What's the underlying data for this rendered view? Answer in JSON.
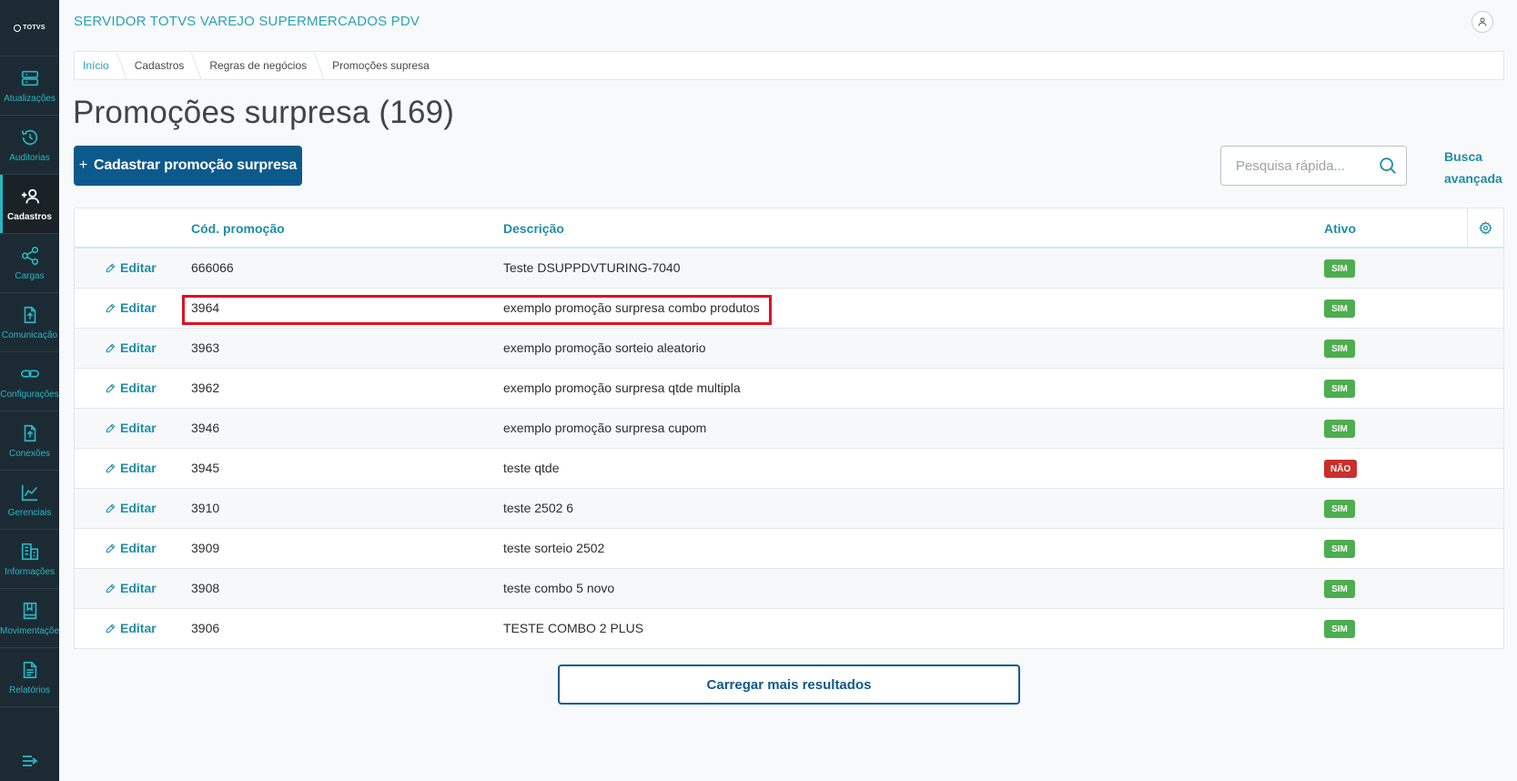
{
  "brand": {
    "logo_text": "TOTVS"
  },
  "header": {
    "app_title": "SERVIDOR TOTVS VAREJO SUPERMERCADOS PDV"
  },
  "sidebar": {
    "items": [
      {
        "label": "Atualizações",
        "icon": "server-icon",
        "active": false
      },
      {
        "label": "Auditorias",
        "icon": "history-icon",
        "active": false
      },
      {
        "label": "Cadastros",
        "icon": "add-user-icon",
        "active": true
      },
      {
        "label": "Cargas",
        "icon": "share-icon",
        "active": false
      },
      {
        "label": "Comunicação",
        "icon": "upload-file-icon",
        "active": false
      },
      {
        "label": "Configurações",
        "icon": "link-icon",
        "active": false
      },
      {
        "label": "Conexões",
        "icon": "upload-file-icon",
        "active": false
      },
      {
        "label": "Gerenciais",
        "icon": "chart-icon",
        "active": false
      },
      {
        "label": "Informações",
        "icon": "building-icon",
        "active": false
      },
      {
        "label": "Movimentações",
        "icon": "book-icon",
        "active": false
      },
      {
        "label": "Relatórios",
        "icon": "document-icon",
        "active": false
      }
    ]
  },
  "breadcrumb": [
    "Início",
    "Cadastros",
    "Regras de negócios",
    "Promoções supresa"
  ],
  "page": {
    "title": "Promoções surpresa (169)",
    "add_button": "Cadastrar promoção surpresa",
    "add_button_plus": "+",
    "search_placeholder": "Pesquisa rápida...",
    "advanced_search_line1": "Busca",
    "advanced_search_line2": "avançada",
    "load_more": "Carregar mais resultados"
  },
  "table": {
    "columns": {
      "code": "Cód. promoção",
      "description": "Descrição",
      "active": "Ativo"
    },
    "edit_label": "Editar",
    "rows": [
      {
        "code": "666066",
        "description": "Teste DSUPPDVTURING-7040",
        "active": "SIM"
      },
      {
        "code": "3964",
        "description": "exemplo promoção surpresa combo produtos",
        "active": "SIM"
      },
      {
        "code": "3963",
        "description": "exemplo promoção sorteio aleatorio",
        "active": "SIM"
      },
      {
        "code": "3962",
        "description": "exemplo promoção surpresa qtde multipla",
        "active": "SIM"
      },
      {
        "code": "3946",
        "description": "exemplo promoção surpresa cupom",
        "active": "SIM"
      },
      {
        "code": "3945",
        "description": "teste qtde",
        "active": "NÃO"
      },
      {
        "code": "3910",
        "description": "teste 2502 6",
        "active": "SIM"
      },
      {
        "code": "3909",
        "description": "teste sorteio 2502",
        "active": "SIM"
      },
      {
        "code": "3908",
        "description": "teste combo 5 novo",
        "active": "SIM"
      },
      {
        "code": "3906",
        "description": "TESTE COMBO 2 PLUS",
        "active": "SIM"
      }
    ]
  },
  "colors": {
    "accent": "#29a3b5",
    "primary": "#0c5a8c",
    "sidebar": "#1c2b33",
    "success": "#4cae4f",
    "danger": "#c9302c",
    "highlight": "#e0101e"
  }
}
